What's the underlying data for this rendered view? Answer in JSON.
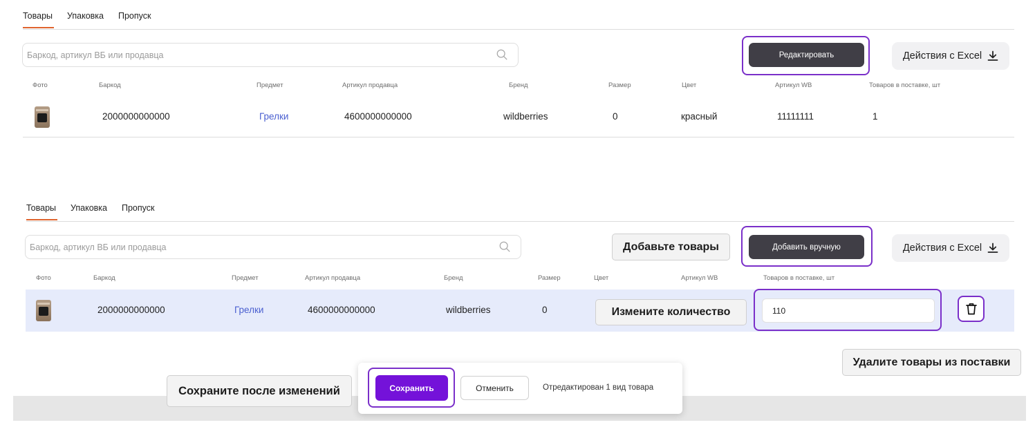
{
  "top": {
    "tabs": [
      "Товары",
      "Упаковка",
      "Пропуск"
    ],
    "search_placeholder": "Баркод, артикул ВБ или продавца",
    "edit_button": "Редактировать",
    "excel_button": "Действия с Excel",
    "headers": {
      "photo": "Фото",
      "barcode": "Баркод",
      "subject": "Предмет",
      "seller_article": "Артикул продавца",
      "brand": "Бренд",
      "size": "Размер",
      "color": "Цвет",
      "wb_article": "Артикул WB",
      "qty": "Товаров в поставке, шт"
    },
    "row": {
      "barcode": "2000000000000",
      "subject": "Грелки",
      "seller_article": "4600000000000",
      "brand": "wildberries",
      "size": "0",
      "color": "красный",
      "wb_article": "11111111",
      "qty": "1"
    }
  },
  "bottom": {
    "tabs": [
      "Товары",
      "Упаковка",
      "Пропуск"
    ],
    "search_placeholder": "Баркод, артикул ВБ или продавца",
    "add_manual_button": "Добавить вручную",
    "excel_button": "Действия с Excel",
    "headers": {
      "photo": "Фото",
      "barcode": "Баркод",
      "subject": "Предмет",
      "seller_article": "Артикул продавца",
      "brand": "Бренд",
      "size": "Размер",
      "color": "Цвет",
      "wb_article": "Артикул WB",
      "qty": "Товаров в поставке, шт"
    },
    "row": {
      "barcode": "2000000000000",
      "subject": "Грелки",
      "seller_article": "4600000000000",
      "brand": "wildberries",
      "size": "0",
      "qty_value": "110"
    },
    "save_button": "Сохранить",
    "cancel_button": "Отменить",
    "status_text": "Отредактирован 1 вид товара"
  },
  "callouts": {
    "add_goods": "Добавьте товары",
    "change_qty": "Измените количество",
    "delete_goods": "Удалите товары из поставки",
    "save_after": "Сохраните после изменений"
  },
  "colors": {
    "accent_purple": "#7412d9",
    "highlight_frame": "#7a2fc9",
    "tab_underline": "#e0642f",
    "dark_button": "#403e46",
    "link": "#4a5fd0",
    "selected_row": "#e6ebfb"
  }
}
